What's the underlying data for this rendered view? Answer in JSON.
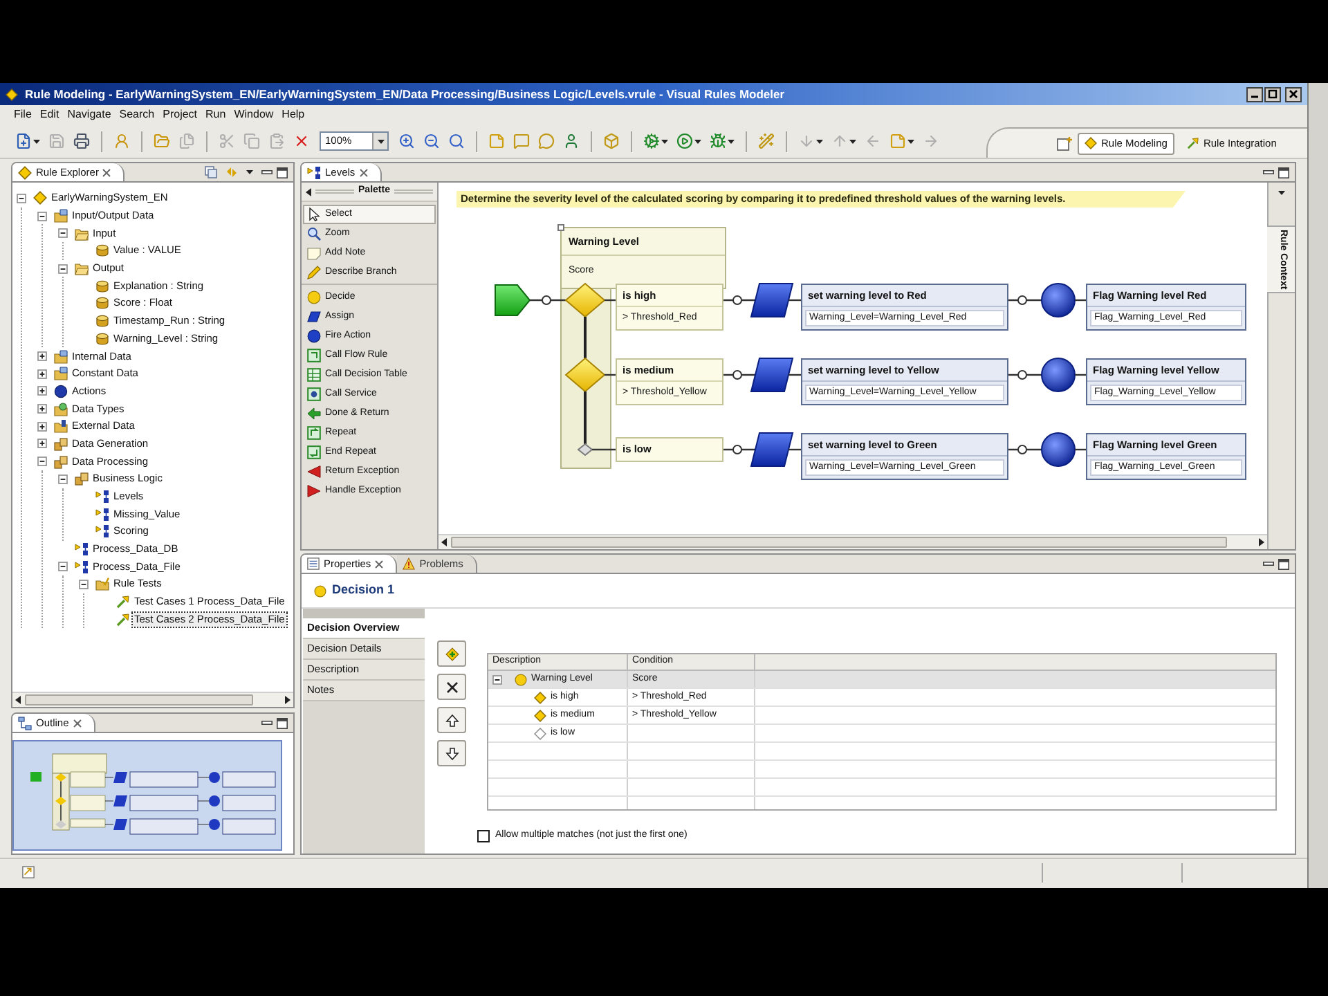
{
  "window": {
    "title": "Rule Modeling - EarlyWarningSystem_EN/EarlyWarningSystem_EN/Data Processing/Business Logic/Levels.vrule - Visual Rules Modeler"
  },
  "menu": [
    "File",
    "Edit",
    "Navigate",
    "Search",
    "Project",
    "Run",
    "Window",
    "Help"
  ],
  "toolbar": [
    [
      {
        "kind": "new",
        "disabled": false,
        "dropdown": true
      },
      {
        "kind": "save",
        "disabled": true,
        "dropdown": false
      },
      {
        "kind": "print",
        "disabled": false,
        "dropdown": false
      }
    ],
    [
      {
        "kind": "export",
        "disabled": false,
        "dropdown": false
      }
    ],
    [
      {
        "kind": "open",
        "disabled": false,
        "dropdown": false
      },
      {
        "kind": "save-all",
        "disabled": true,
        "dropdown": false
      }
    ],
    [
      {
        "kind": "cut",
        "disabled": true,
        "dropdown": false
      },
      {
        "kind": "copy",
        "disabled": true,
        "dropdown": false
      },
      {
        "kind": "paste",
        "disabled": true,
        "dropdown": false
      },
      {
        "kind": "delete",
        "disabled": false,
        "dropdown": false
      },
      {
        "kind": "zoom",
        "value": "100%"
      },
      {
        "kind": "zoom-in",
        "disabled": false,
        "dropdown": false
      },
      {
        "kind": "zoom-out",
        "disabled": false,
        "dropdown": false
      },
      {
        "kind": "zoom-fit",
        "disabled": false,
        "dropdown": false
      }
    ],
    [
      {
        "kind": "add-note",
        "disabled": false,
        "dropdown": false
      },
      {
        "kind": "note",
        "disabled": false,
        "dropdown": false
      },
      {
        "kind": "comment",
        "disabled": false,
        "dropdown": false
      },
      {
        "kind": "user",
        "disabled": false,
        "dropdown": false
      }
    ],
    [
      {
        "kind": "box",
        "disabled": false,
        "dropdown": false
      }
    ],
    [
      {
        "kind": "run-config",
        "disabled": false,
        "dropdown": true
      },
      {
        "kind": "run",
        "disabled": false,
        "dropdown": true
      },
      {
        "kind": "test",
        "disabled": false,
        "dropdown": true
      }
    ],
    [
      {
        "kind": "wand",
        "disabled": false,
        "dropdown": false
      }
    ],
    [
      {
        "kind": "next",
        "disabled": true,
        "dropdown": true
      },
      {
        "kind": "previous",
        "disabled": true,
        "dropdown": true
      },
      {
        "kind": "back",
        "disabled": true,
        "dropdown": false
      },
      {
        "kind": "annotate",
        "disabled": false,
        "dropdown": true
      },
      {
        "kind": "forward",
        "disabled": true,
        "dropdown": false
      }
    ]
  ],
  "perspectives": [
    {
      "label": "Rule Modeling",
      "kind": "modeling",
      "selected": true
    },
    {
      "label": "Rule Integration",
      "kind": "integration",
      "selected": false
    }
  ],
  "explorer": {
    "title": "Rule Explorer",
    "tree": [
      {
        "label": "EarlyWarningSystem_EN",
        "kind": "project",
        "expanded": true,
        "selected": false,
        "children": [
          {
            "label": "Input/Output Data",
            "kind": "data",
            "expanded": true,
            "selected": false,
            "children": [
              {
                "label": "Input",
                "kind": "folder",
                "expanded": true,
                "selected": false,
                "children": [
                  {
                    "label": "Value : VALUE",
                    "kind": "variable",
                    "selected": false
                  }
                ]
              },
              {
                "label": "Output",
                "kind": "folder",
                "expanded": true,
                "selected": false,
                "children": [
                  {
                    "label": "Explanation : String",
                    "kind": "variable",
                    "selected": false
                  },
                  {
                    "label": "Score : Float",
                    "kind": "variable",
                    "selected": false
                  },
                  {
                    "label": "Timestamp_Run : String",
                    "kind": "variable",
                    "selected": false
                  },
                  {
                    "label": "Warning_Level : String",
                    "kind": "variable",
                    "selected": false
                  }
                ]
              }
            ]
          },
          {
            "label": "Internal Data",
            "kind": "data",
            "expanded": false,
            "selected": false
          },
          {
            "label": "Constant Data",
            "kind": "data",
            "expanded": false,
            "selected": false
          },
          {
            "label": "Actions",
            "kind": "actions",
            "expanded": false,
            "selected": false
          },
          {
            "label": "Data Types",
            "kind": "types",
            "expanded": false,
            "selected": false
          },
          {
            "label": "External Data",
            "kind": "external",
            "expanded": false,
            "selected": false
          },
          {
            "label": "Data Generation",
            "kind": "package",
            "expanded": false,
            "selected": false
          },
          {
            "label": "Data Processing",
            "kind": "package",
            "expanded": true,
            "selected": false,
            "children": [
              {
                "label": "Business Logic",
                "kind": "package",
                "expanded": true,
                "selected": false,
                "children": [
                  {
                    "label": "Levels",
                    "kind": "rule",
                    "selected": false
                  },
                  {
                    "label": "Missing_Value",
                    "kind": "rule",
                    "selected": false
                  },
                  {
                    "label": "Scoring",
                    "kind": "rule",
                    "selected": false
                  }
                ]
              },
              {
                "label": "Process_Data_DB",
                "kind": "rule",
                "selected": false
              },
              {
                "label": "Process_Data_File",
                "kind": "rule",
                "expanded": true,
                "selected": false,
                "children": [
                  {
                    "label": "Rule Tests",
                    "kind": "tests",
                    "expanded": true,
                    "selected": false,
                    "children": [
                      {
                        "label": "Test Cases 1 Process_Data_File",
                        "kind": "testcase",
                        "selected": false
                      },
                      {
                        "label": "Test Cases 2 Process_Data_File",
                        "kind": "testcase",
                        "selected": true
                      }
                    ]
                  }
                ]
              }
            ]
          }
        ]
      }
    ]
  },
  "outline": {
    "title": "Outline"
  },
  "editor": {
    "tab": "Levels",
    "palette": {
      "title": "Palette",
      "groups": [
        [
          {
            "label": "Select",
            "kind": "select",
            "selected": true
          },
          {
            "label": "Zoom",
            "kind": "zoom",
            "selected": false
          },
          {
            "label": "Add Note",
            "kind": "note",
            "selected": false
          },
          {
            "label": "Describe Branch",
            "kind": "describe",
            "selected": false
          }
        ],
        [
          {
            "label": "Decide",
            "kind": "decide",
            "selected": false
          },
          {
            "label": "Assign",
            "kind": "assign",
            "selected": false
          },
          {
            "label": "Fire Action",
            "kind": "fire",
            "selected": false
          },
          {
            "label": "Call Flow Rule",
            "kind": "flow",
            "selected": false
          },
          {
            "label": "Call Decision Table",
            "kind": "table",
            "selected": false
          },
          {
            "label": "Call Service",
            "kind": "service",
            "selected": false
          },
          {
            "label": "Done & Return",
            "kind": "done",
            "selected": false
          },
          {
            "label": "Repeat",
            "kind": "repeat",
            "selected": false
          },
          {
            "label": "End Repeat",
            "kind": "end-repeat",
            "selected": false
          },
          {
            "label": "Return Exception",
            "kind": "return-exception",
            "selected": false
          },
          {
            "label": "Handle Exception",
            "kind": "handle-exception",
            "selected": false
          }
        ]
      ]
    },
    "diagram": {
      "note": "Determine the severity level of the calculated scoring by comparing it to predefined threshold values of the warning levels.",
      "decision": {
        "title": "Warning Level",
        "subject": "Score"
      },
      "branches": [
        {
          "label": "is high",
          "condition": "> Threshold_Red",
          "assignment": {
            "title": "set warning level to Red",
            "expression": "Warning_Level=Warning_Level_Red"
          },
          "action": {
            "title": "Flag Warning level Red",
            "expression": "Flag_Warning_Level_Red"
          }
        },
        {
          "label": "is medium",
          "condition": "> Threshold_Yellow",
          "assignment": {
            "title": "set warning level to Yellow",
            "expression": "Warning_Level=Warning_Level_Yellow"
          },
          "action": {
            "title": "Flag Warning level Yellow",
            "expression": "Flag_Warning_Level_Yellow"
          }
        },
        {
          "label": "is low",
          "assignment": {
            "title": "set warning level to Green",
            "expression": "Warning_Level=Warning_Level_Green"
          },
          "action": {
            "title": "Flag Warning level Green",
            "expression": "Flag_Warning_Level_Green"
          }
        }
      ]
    },
    "side_tab": "Rule Context"
  },
  "properties": {
    "tabs": [
      {
        "label": "Properties",
        "kind": "properties",
        "selected": true
      },
      {
        "label": "Problems",
        "kind": "problems",
        "selected": false
      }
    ],
    "heading": "Decision 1",
    "sections": [
      {
        "label": "Decision Overview",
        "selected": true
      },
      {
        "label": "Decision Details",
        "selected": false
      },
      {
        "label": "Description",
        "selected": false
      },
      {
        "label": "Notes",
        "selected": false
      }
    ],
    "table": {
      "columns": [
        "Description",
        "Condition"
      ],
      "rows": [
        {
          "description": "Warning Level",
          "condition": "Score",
          "expanded": true,
          "selected": true,
          "children": [
            {
              "description": "is high",
              "condition": "> Threshold_Red",
              "selected": false
            },
            {
              "description": "is medium",
              "condition": "> Threshold_Yellow",
              "selected": false
            },
            {
              "description": "is low",
              "selected": false
            }
          ]
        }
      ]
    },
    "allow_multiple": {
      "label": "Allow multiple matches (not just the first one)",
      "checked": false
    }
  }
}
